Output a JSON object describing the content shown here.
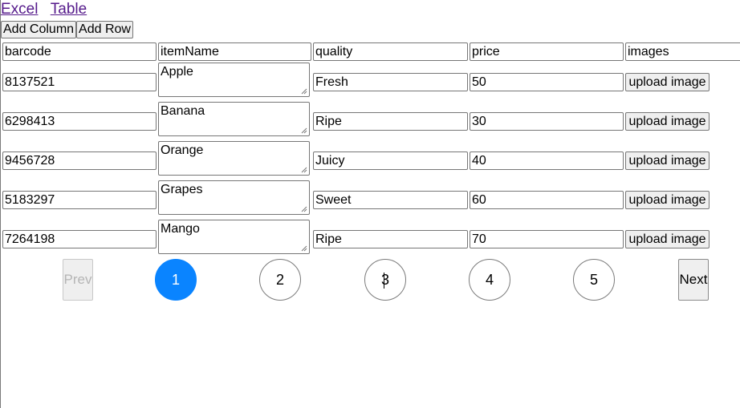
{
  "nav": {
    "excel_link": "Excel",
    "table_link": "Table"
  },
  "toolbar": {
    "add_column": "Add Column",
    "add_row": "Add Row"
  },
  "headers": [
    "barcode",
    "itemName",
    "quality",
    "price",
    "images"
  ],
  "rows": [
    {
      "barcode": "8137521",
      "itemName": "Apple",
      "quality": "Fresh",
      "price": "50",
      "image_button": "upload image"
    },
    {
      "barcode": "6298413",
      "itemName": "Banana",
      "quality": "Ripe",
      "price": "30",
      "image_button": "upload image"
    },
    {
      "barcode": "9456728",
      "itemName": "Orange",
      "quality": "Juicy",
      "price": "40",
      "image_button": "upload image"
    },
    {
      "barcode": "5183297",
      "itemName": "Grapes",
      "quality": "Sweet",
      "price": "60",
      "image_button": "upload image"
    },
    {
      "barcode": "7264198",
      "itemName": "Mango",
      "quality": "Ripe",
      "price": "70",
      "image_button": "upload image"
    }
  ],
  "pagination": {
    "prev": "Prev",
    "pages": [
      "1",
      "2",
      "3",
      "4",
      "5"
    ],
    "current": "1",
    "next": "Next"
  },
  "colors": {
    "active_page": "#0a84ff",
    "link": "#551a8b",
    "button_bg": "#efefef"
  }
}
